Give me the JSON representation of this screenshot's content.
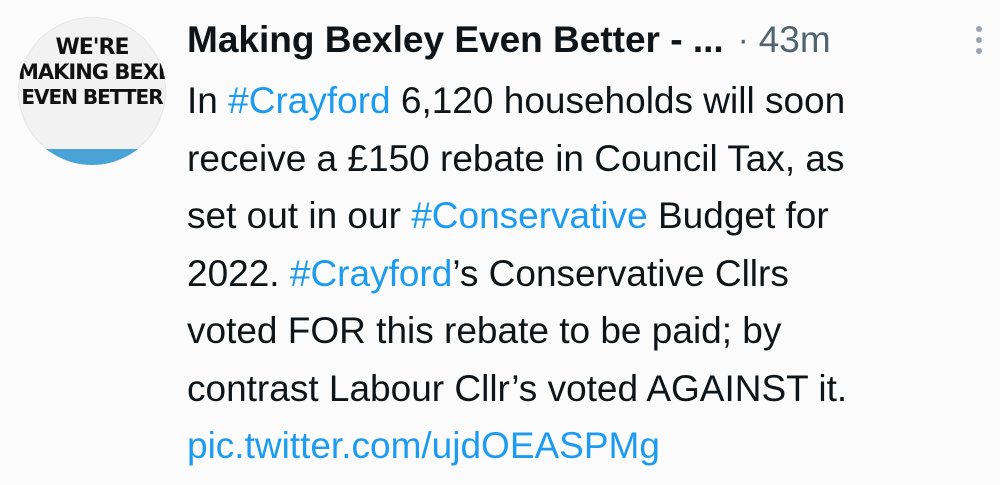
{
  "avatar": {
    "logo_line1": "WE'RE",
    "logo_line2": "MAKING BEXLEY",
    "logo_line3": "EVEN BETTER"
  },
  "header": {
    "author_name": "Making Bexley Even Better - ...",
    "separator": "·",
    "time": "43m"
  },
  "tweet": {
    "line1_pre": "In ",
    "line1_tag": "#Crayford",
    "line1_post": " 6,120 households will soon",
    "line2": "receive a £150 rebate in Council Tax, as",
    "line3_pre": "set out in our ",
    "line3_tag": "#Conservative",
    "line3_post": " Budget for",
    "line4_pre": "2022. ",
    "line4_tag": "#Crayford",
    "line4_post": "’s Conservative Cllrs",
    "line5": "voted FOR this rebate to be paid; by",
    "line6": "contrast Labour Cllr’s voted AGAINST it.",
    "link": "pic.twitter.com/ujdOEASPMg"
  },
  "colors": {
    "link": "#1d9bf0",
    "text": "#0f1419",
    "muted": "#536471",
    "avatar_band": "#4aa3d6"
  },
  "icons": [
    "more-options-icon"
  ]
}
